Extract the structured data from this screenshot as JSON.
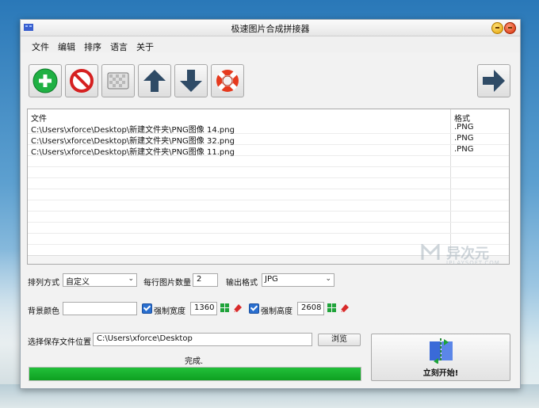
{
  "window": {
    "title": "极速图片合成拼接器"
  },
  "menu": [
    "文件",
    "编辑",
    "排序",
    "语言",
    "关于"
  ],
  "toolbar": {
    "add": "add-icon",
    "remove": "remove-icon",
    "clear": "clear-icon",
    "up": "arrow-up-icon",
    "down": "arrow-down-icon",
    "help": "lifebuoy-icon",
    "next": "arrow-right-icon"
  },
  "filelist": {
    "col_file": "文件",
    "col_format": "格式",
    "rows": [
      {
        "path": "C:\\Users\\xforce\\Desktop\\新建文件夹\\PNG图像 14.png",
        "format": ".PNG"
      },
      {
        "path": "C:\\Users\\xforce\\Desktop\\新建文件夹\\PNG图像 32.png",
        "format": ".PNG"
      },
      {
        "path": "C:\\Users\\xforce\\Desktop\\新建文件夹\\PNG图像 11.png",
        "format": ".PNG"
      }
    ]
  },
  "options": {
    "arrange_label": "排列方式",
    "arrange_value": "自定义",
    "per_row_label": "每行图片数量",
    "per_row_value": "2",
    "output_format_label": "输出格式",
    "output_format_value": "JPG",
    "bg_color_label": "背景颜色",
    "force_width_label": "强制宽度",
    "force_width_value": "1360",
    "force_height_label": "强制高度",
    "force_height_value": "2608"
  },
  "save": {
    "label": "选择保存文件位置",
    "path": "C:\\Users\\xforce\\Desktop",
    "browse": "浏览"
  },
  "status": {
    "text": "完成.",
    "progress": 1.0
  },
  "start_button": "立刻开始!",
  "watermark": {
    "text": "异次元",
    "sub": "IPLAYSOFT.COM"
  },
  "colors": {
    "progress": "#19b02e",
    "accent": "#2a6fcf"
  }
}
